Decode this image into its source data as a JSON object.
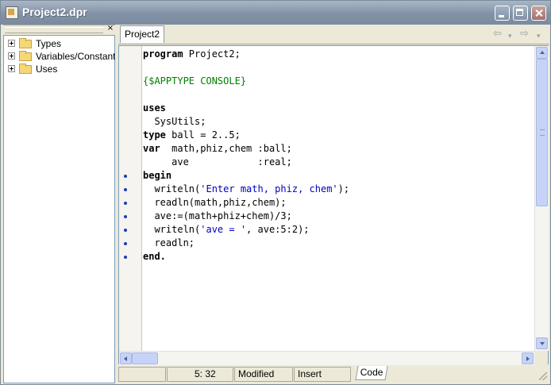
{
  "window": {
    "title": "Project2.dpr"
  },
  "explorer": {
    "close_glyph": "×",
    "items": [
      {
        "label": "Types",
        "expander": "+"
      },
      {
        "label": "Variables/Constants",
        "expander": "+"
      },
      {
        "label": "Uses",
        "expander": "+"
      }
    ]
  },
  "editor": {
    "tab_label": "Project2",
    "nav": {
      "back": "⇦",
      "back_menu": "▾",
      "forward": "⇨",
      "forward_menu": "▾"
    },
    "lines": [
      {
        "kw": "program",
        "rest": " Project2;"
      },
      {
        "text": ""
      },
      {
        "dir": "{$APPTYPE CONSOLE}"
      },
      {
        "text": ""
      },
      {
        "kw": "uses"
      },
      {
        "text": "  SysUtils;"
      },
      {
        "kw": "type",
        "rest": " ball = 2..5;"
      },
      {
        "kw": "var",
        "rest": "  math,phiz,chem :ball;"
      },
      {
        "text": "     ave            :real;"
      },
      {
        "kw": "begin",
        "dot": true
      },
      {
        "pre": "  writeln(",
        "str": "'Enter math, phiz, chem'",
        "post": ");",
        "dot": true
      },
      {
        "text": "  readln(math,phiz,chem);",
        "dot": true
      },
      {
        "text": "  ave:=(math+phiz+chem)/3;",
        "dot": true
      },
      {
        "pre": "  writeln(",
        "str": "'ave = '",
        "post": ", ave:5:2);",
        "dot": true
      },
      {
        "text": "  readln;",
        "dot": true
      },
      {
        "kw": "end.",
        "dot": true
      }
    ]
  },
  "status": {
    "position": "5:  32",
    "modified": "Modified",
    "mode": "Insert",
    "view_tab": "Code"
  },
  "colors": {
    "directive": "#008000",
    "string": "#0000c0",
    "breakpoint_dot": "#1c3cb8"
  }
}
